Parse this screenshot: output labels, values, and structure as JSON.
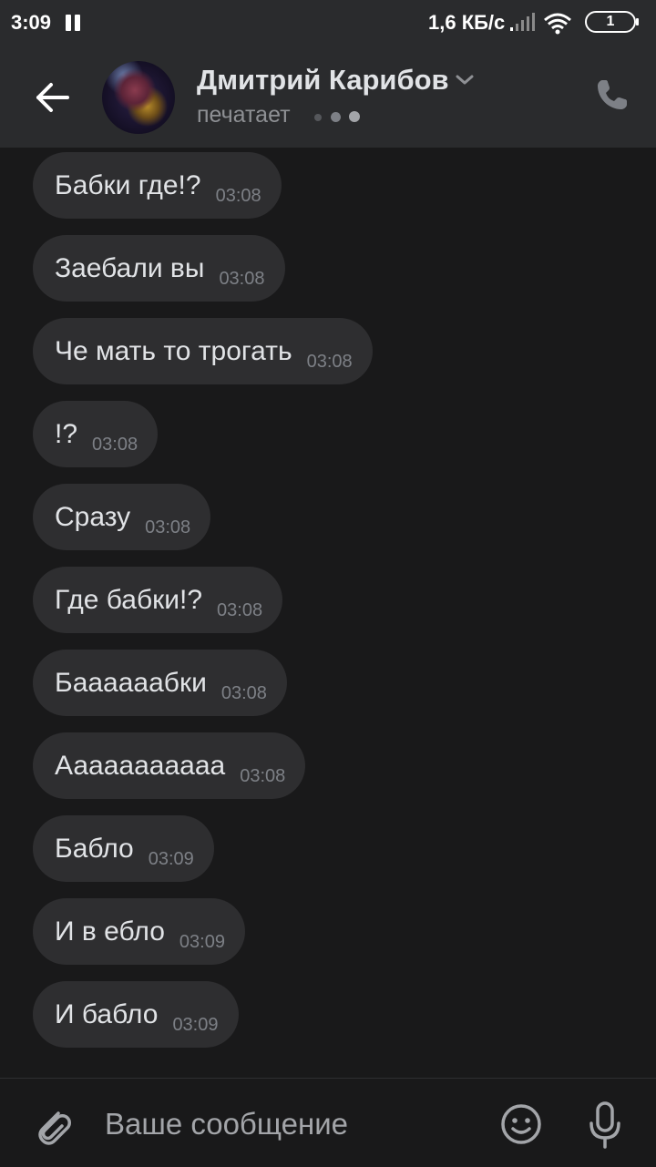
{
  "status_bar": {
    "time": "3:09",
    "network_speed": "1,6 КБ/с",
    "battery_level": "1",
    "icons": [
      "pause-icon",
      "signal-icon",
      "wifi-icon",
      "battery-icon"
    ]
  },
  "header": {
    "contact_name": "Дмитрий Карибов",
    "status": "печатает",
    "icons": [
      "back-arrow-icon",
      "chevron-down-icon",
      "phone-icon"
    ]
  },
  "messages": [
    {
      "text": "Бабки где!?",
      "time": "03:08"
    },
    {
      "text": "Заебали вы",
      "time": "03:08"
    },
    {
      "text": "Че мать то трогать",
      "time": "03:08"
    },
    {
      "text": "!?",
      "time": "03:08"
    },
    {
      "text": "Сразу",
      "time": "03:08"
    },
    {
      "text": "Где бабки!?",
      "time": "03:08"
    },
    {
      "text": "Баааааабки",
      "time": "03:08"
    },
    {
      "text": "Ааааааааааа",
      "time": "03:08"
    },
    {
      "text": "Бабло",
      "time": "03:09"
    },
    {
      "text": "И в ебло",
      "time": "03:09"
    },
    {
      "text": "И бабло",
      "time": "03:09"
    }
  ],
  "composer": {
    "placeholder": "Ваше сообщение",
    "value": "",
    "icons": [
      "paperclip-icon",
      "emoji-icon",
      "microphone-icon"
    ]
  },
  "colors": {
    "background": "#19191a",
    "header_bg": "#2a2b2d",
    "bubble_bg": "#2e2e30",
    "text": "#e1e3e6",
    "secondary_text": "#8e9094"
  }
}
